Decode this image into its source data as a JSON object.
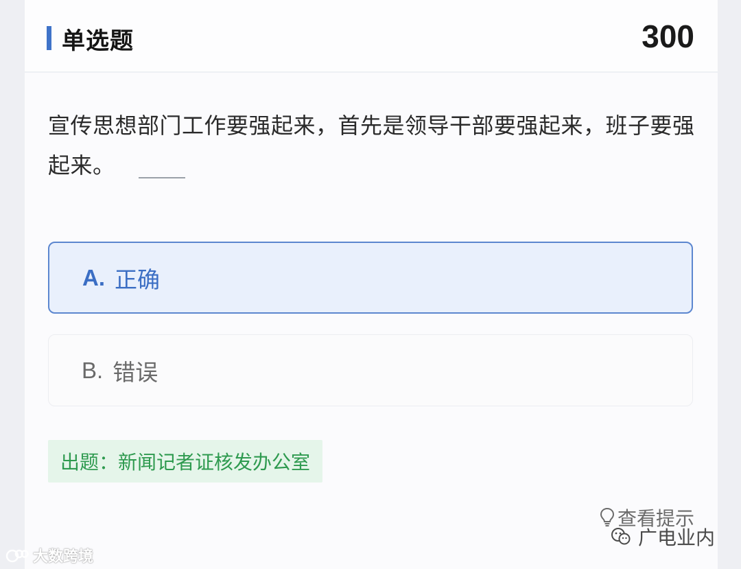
{
  "header": {
    "title": "单选题",
    "score": "300"
  },
  "question": {
    "text": "宣传思想部门工作要强起来，首先是领导干部要强起来，班子要强起来。"
  },
  "options": [
    {
      "letter": "A.",
      "label": "正确",
      "selected": true
    },
    {
      "letter": "B.",
      "label": "错误",
      "selected": false
    }
  ],
  "source": {
    "text": "出题：新闻记者证核发办公室"
  },
  "hint": {
    "label": "查看提示",
    "icon": "lightbulb-icon"
  },
  "watermarks": {
    "right": "广电业内",
    "left": "大数跨境"
  },
  "colors": {
    "accent": "#3f73c9",
    "selected_bg": "#e9f0fc",
    "source_bg": "#e5f5ea",
    "source_text": "#2e9a4f"
  }
}
